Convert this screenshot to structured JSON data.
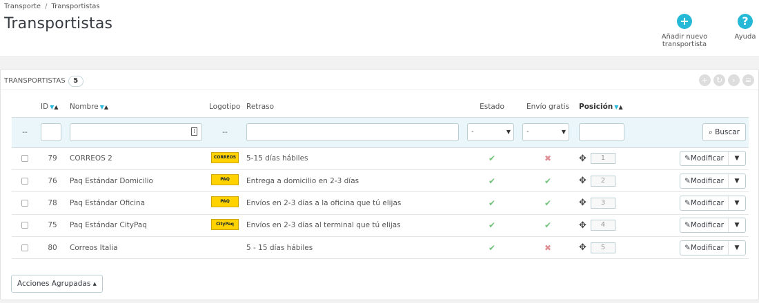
{
  "breadcrumb": {
    "root": "Transporte",
    "sep": "/",
    "current": "Transportistas"
  },
  "header": {
    "title": "Transportistas",
    "add_label": "Añadir nuevo transportista",
    "help_label": "Ayuda",
    "add_icon": "+",
    "help_icon": "?"
  },
  "panel": {
    "title": "TRANSPORTISTAS",
    "count": "5"
  },
  "columns": {
    "id": "ID",
    "name": "Nombre",
    "logo": "Logotipo",
    "delay": "Retraso",
    "status": "Estado",
    "free": "Envío gratis",
    "position": "Posición"
  },
  "filters": {
    "checkbox_dash": "--",
    "logo_dash": "--",
    "status_value": "-",
    "free_value": "-",
    "search_label": "Buscar"
  },
  "rows": [
    {
      "id": "79",
      "name": "CORREOS 2",
      "logo": "CORREOS",
      "delay": "5-15 días hábiles",
      "status": "✔",
      "free": "✖",
      "position": "1",
      "edit": "Modificar"
    },
    {
      "id": "76",
      "name": "Paq Estándar Domicilio",
      "logo": "PAQ",
      "delay": "Entrega a domicilio en 2-3 días",
      "status": "✔",
      "free": "✔",
      "position": "2",
      "edit": "Modificar"
    },
    {
      "id": "78",
      "name": "Paq Estándar Oficina",
      "logo": "PAQ",
      "delay": "Envíos en 2-3 días a la oficina que tú elijas",
      "status": "✔",
      "free": "✔",
      "position": "3",
      "edit": "Modificar"
    },
    {
      "id": "75",
      "name": "Paq Estándar CityPaq",
      "logo": "CityPaq",
      "delay": "Envíos en 2-3 días al terminal que tú elijas",
      "status": "✔",
      "free": "✔",
      "position": "4",
      "edit": "Modificar"
    },
    {
      "id": "80",
      "name": "Correos Italia",
      "logo": "",
      "delay": "5 - 15 días hábiles",
      "status": "✔",
      "free": "✖",
      "position": "5",
      "edit": "Modificar"
    }
  ],
  "bulk_label": "Acciones Agrupadas ▴",
  "colors": {
    "accent": "#25b9d7",
    "ok": "#72c279",
    "no": "#e08f95"
  }
}
